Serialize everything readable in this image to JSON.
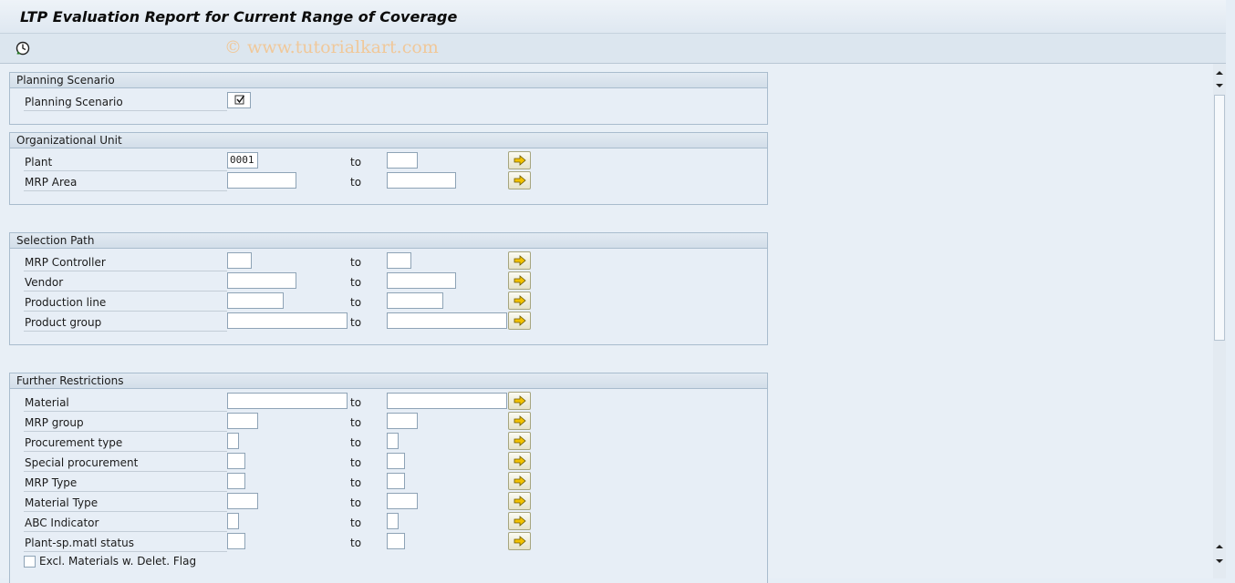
{
  "window": {
    "title": "LTP Evaluation Report for Current Range of Coverage",
    "watermark": "© www.tutorialkart.com"
  },
  "toolbar": {
    "execute_icon": "execute-clock-icon"
  },
  "groups": {
    "planning": {
      "title": "Planning Scenario",
      "label": "Planning Scenario",
      "checked": true
    },
    "org": {
      "title": "Organizational Unit",
      "rows": [
        {
          "label": "Plant",
          "from": "0001",
          "to": ""
        },
        {
          "label": "MRP Area",
          "from": "",
          "to": ""
        }
      ]
    },
    "selection": {
      "title": "Selection Path",
      "rows": [
        {
          "label": "MRP Controller",
          "from": "",
          "to": ""
        },
        {
          "label": "Vendor",
          "from": "",
          "to": ""
        },
        {
          "label": "Production line",
          "from": "",
          "to": ""
        },
        {
          "label": "Product group",
          "from": "",
          "to": ""
        }
      ]
    },
    "further": {
      "title": "Further Restrictions",
      "rows": [
        {
          "label": "Material",
          "from": "",
          "to": ""
        },
        {
          "label": "MRP group",
          "from": "",
          "to": ""
        },
        {
          "label": "Procurement type",
          "from": "",
          "to": ""
        },
        {
          "label": "Special procurement",
          "from": "",
          "to": ""
        },
        {
          "label": "MRP Type",
          "from": "",
          "to": ""
        },
        {
          "label": "Material Type",
          "from": "",
          "to": ""
        },
        {
          "label": "ABC Indicator",
          "from": "",
          "to": ""
        },
        {
          "label": "Plant-sp.matl status",
          "from": "",
          "to": ""
        }
      ],
      "checkbox_label": "Excl. Materials w. Delet. Flag",
      "checkbox_checked": false
    }
  },
  "common": {
    "to_label": "to"
  },
  "colors": {
    "accent": "#e6eef6",
    "arrow_button": "#e5e2c9",
    "arrow_icon": "#f2c200"
  }
}
